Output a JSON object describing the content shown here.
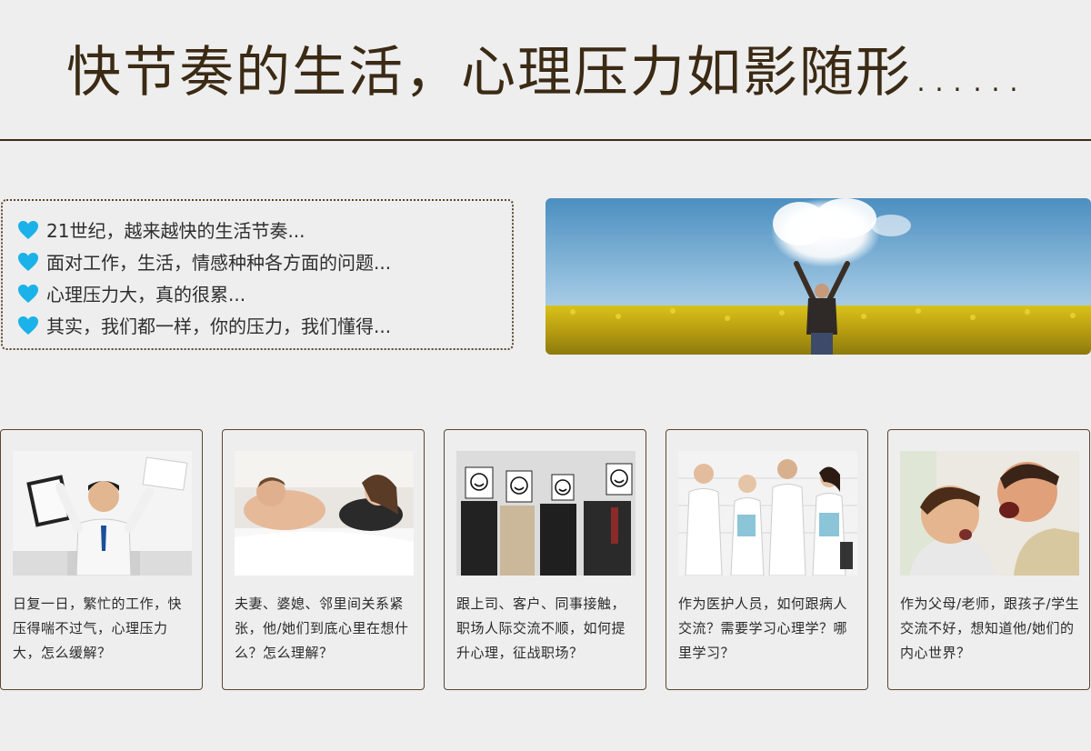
{
  "header": {
    "title": "快节奏的生活，心理压力如影随形……"
  },
  "intro": {
    "items": [
      "21世纪，越来越快的生活节奏...",
      "面对工作，生活，情感种种各方面的问题...",
      "心理压力大，真的很累...",
      "其实，我们都一样，你的压力，我们懂得..."
    ],
    "bullet_icon": "heart-icon",
    "bullet_color": "#1ab2e8"
  },
  "cards": [
    {
      "text": "日复一日，繁忙的工作，快压得喘不过气，心理压力大，怎么缓解？"
    },
    {
      "text": "夫妻、婆媳、邻里间关系紧张，他/她们到底心里在想什么？怎么理解？"
    },
    {
      "text": "跟上司、客户、同事接触，职场人际交流不顺，如何提升心理，征战职场？"
    },
    {
      "text": "作为医护人员，如何跟病人交流？需要学习心理学？哪里学习？"
    },
    {
      "text": "作为父母/老师，跟孩子/学生交流不好，想知道他/她们的内心世界？"
    }
  ],
  "colors": {
    "accent_dark": "#3b2a14",
    "background": "#eeeeee"
  }
}
